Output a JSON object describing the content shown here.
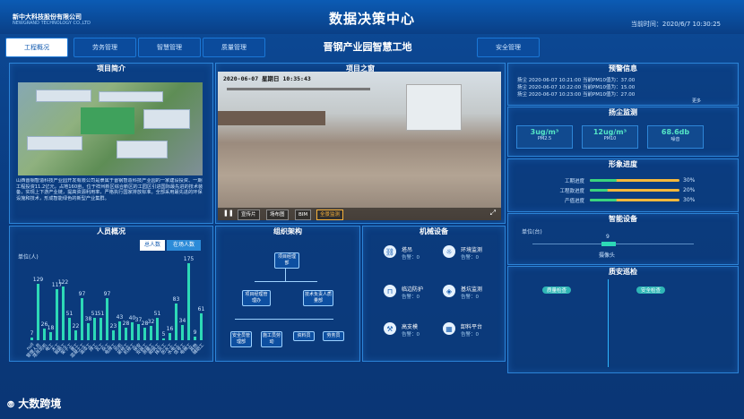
{
  "header": {
    "company": "新中大科技股份有限公司",
    "company_en": "NEWGRAND TECHNOLOGY CO.,LTD",
    "title": "数据决策中心",
    "time_label": "当前时间：",
    "time_value": "2020/6/7 10:30:25"
  },
  "nav": {
    "tabs": [
      "工程概况",
      "劳务管理",
      "智慧管理",
      "质量管理"
    ],
    "active": "工程概况",
    "site_title": "晋钢产业园智慧工地",
    "right_tab": "安全管理"
  },
  "project_intro": {
    "title": "项目简介",
    "text": "山西晋钢智造科技产业园开发有限公司是隶属于晋钢智造科技产业园的一家建设投资、一期工程投资11.2亿元，占地160亩，位于祥州新区综合新区的工园区引进国际最先进的技术装备，实现上下游产业链，提高资源利用率，严格执行国家排放标准。全部采用最先进的环保设施和技术，形成智能绿色的新型产业集群。"
  },
  "video": {
    "title": "项目之窗",
    "timestamp": "2020-06-07 星期日 10:35:43",
    "buttons": [
      "宣传片",
      "场布图",
      "BIM",
      "全景监测"
    ],
    "active_button": "全景监测"
  },
  "warning": {
    "title": "预警信息",
    "items": [
      "扬尘 2020-06-07 10:21:00 当前PM10值为：37.00",
      "扬尘 2020-06-07 10:22:00 当前PM10值为：15.00",
      "扬尘 2020-06-07 10:23:00 当前PM10值为：27.00"
    ],
    "more": "更多"
  },
  "dust": {
    "title": "扬尘监测",
    "items": [
      {
        "value": "3ug/m³",
        "label": "PM2.5"
      },
      {
        "value": "12ug/m³",
        "label": "PM10"
      },
      {
        "value": "68.6db",
        "label": "噪音"
      }
    ]
  },
  "progress": {
    "title": "形象进度",
    "items": [
      {
        "label": "工期进度",
        "value": "30%",
        "fraction": 0.3
      },
      {
        "label": "工程款进度",
        "value": "20%",
        "fraction": 0.2
      },
      {
        "label": "产值进度",
        "value": "30%",
        "fraction": 0.3
      }
    ]
  },
  "smart_device": {
    "title": "智能设备",
    "unit": "单位(台)",
    "value": "9",
    "item_label": "摄像头"
  },
  "quality": {
    "title": "质安巡检",
    "tags": [
      "质量检查",
      "安全检查"
    ]
  },
  "personnel": {
    "title": "人员概况",
    "tabs": [
      "总人数",
      "在场人数"
    ],
    "active_tab": "总人数",
    "ylabel": "单位(人)"
  },
  "chart_data": {
    "type": "bar",
    "title": "人员概况",
    "ylabel": "单位(人)",
    "values": [
      7,
      129,
      26,
      18,
      117,
      122,
      51,
      22,
      97,
      38,
      51,
      51,
      97,
      23,
      43,
      28,
      40,
      37,
      28,
      32,
      51,
      5,
      16,
      83,
      34,
      175,
      9,
      61
    ],
    "categories": [
      "null",
      "管理人员",
      "塔吊司机",
      "电工",
      "木工",
      "钢筋工",
      "架子工",
      "普工",
      "混凝土工",
      "油漆工",
      "焊工",
      "瓦工",
      "杂工",
      "电焊工",
      "司机",
      "装修工",
      "机修工",
      "保安",
      "安装工",
      "测量工",
      "砌筑工",
      "抹灰工",
      "防水工",
      "水电工",
      "信号工",
      "电梯工",
      "其他",
      "辅助工"
    ],
    "ylim": [
      0,
      180
    ]
  },
  "org": {
    "title": "组织架构",
    "root": "项目经理部",
    "level2": [
      "项目经理管理办",
      "技术负责人质量部"
    ],
    "level3": [
      "安全员管理部",
      "施工员劳动",
      "资料员",
      "劳务员"
    ]
  },
  "machinery": {
    "title": "机械设备",
    "items": [
      {
        "name": "塔吊",
        "status": "告警：0",
        "icon": "crane-icon"
      },
      {
        "name": "环境监测",
        "status": "告警：0",
        "icon": "environment-icon"
      },
      {
        "name": "临边防护",
        "status": "告警：0",
        "icon": "guardrail-icon"
      },
      {
        "name": "基坑监测",
        "status": "告警：0",
        "icon": "pit-icon"
      },
      {
        "name": "高支模",
        "status": "告警：0",
        "icon": "formwork-icon"
      },
      {
        "name": "卸料平台",
        "status": "告警：0",
        "icon": "platform-icon"
      }
    ]
  },
  "footer": {
    "brand": "大数跨境"
  }
}
